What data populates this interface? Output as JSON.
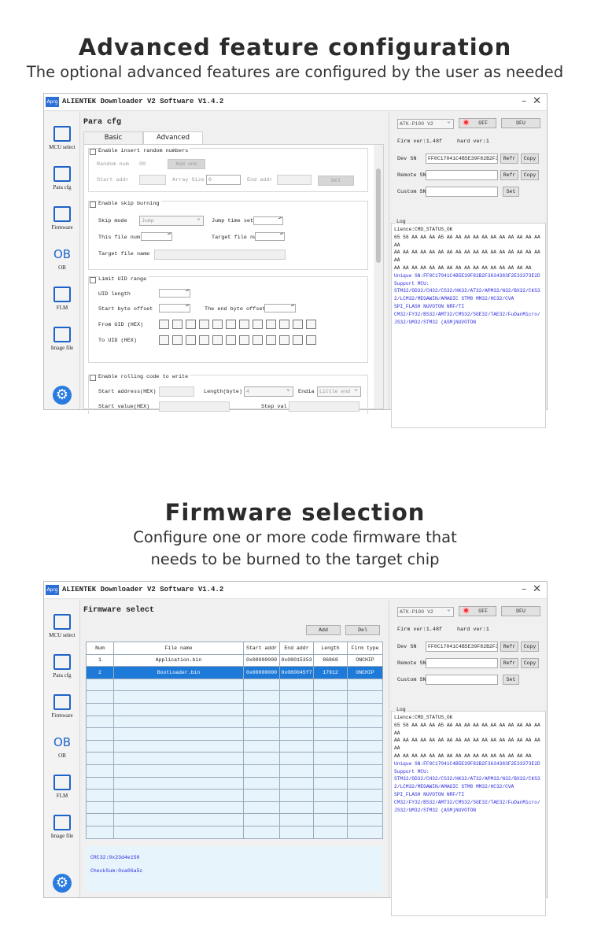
{
  "section1": {
    "heading": "Advanced feature configuration",
    "sub": "The optional advanced features are configured by the user as needed"
  },
  "section2": {
    "heading": "Firmware selection",
    "sub_line1": "Configure one or more code firmware that",
    "sub_line2": "needs to be burned to the target chip"
  },
  "window": {
    "icon_text": "Aprg",
    "title": "ALIENTEK  Downloader V2 Software V1.4.2",
    "min": "–",
    "close": "✕"
  },
  "sidebar": {
    "items": [
      {
        "label": "MCU select",
        "icon": "chip-icon"
      },
      {
        "label": "Para cfg",
        "icon": "list-icon"
      },
      {
        "label": "Firmware",
        "icon": "firmware-icon"
      },
      {
        "label": "OB",
        "icon": "ob-icon"
      },
      {
        "label": "FLM",
        "icon": "flm-icon"
      },
      {
        "label": "Image file",
        "icon": "image-file-icon"
      }
    ],
    "ob_glyph": "OB",
    "settings_icon": "gear-icon"
  },
  "para": {
    "title": "Para cfg",
    "tabs": [
      "Basic",
      "Advanced"
    ],
    "g1": {
      "title": "Enable insert random numbers",
      "random_num": "Random num",
      "random_val": "00",
      "add_one": "Add one",
      "start_addr": "Start addr",
      "array_size": "Array Size",
      "array_val": "0",
      "end_addr": "End addr",
      "del": "Del"
    },
    "g2": {
      "title": "Enable skip burning",
      "skip_mode": "Skip mode",
      "skip_val": "Jump",
      "jump_time_set": "Jump time set",
      "this_file_num": "This file num",
      "target_file_num": "Target file num",
      "target_file_name": "Target file name"
    },
    "g3": {
      "title": "Limit UID range",
      "uid_length": "UID length",
      "start_byte_offset": "Start byte offset",
      "end_byte_offset": "The end byte offset",
      "from_uid": "From UID (HEX)",
      "to_uid": "To UID (HEX)"
    },
    "g4": {
      "title": "Enable rolling code to write",
      "start_address": "Start address(HEX)",
      "length_byte": "Length(byte)",
      "length_val": "4",
      "endia": "Endia",
      "endia_val": "Little end",
      "start_value": "Start value(HEX)",
      "step_val": "Step val"
    }
  },
  "rightpanel": {
    "device": "ATK-P100 V2",
    "off": "OFF",
    "dfu": "DFU",
    "firm_ver": "Firm ver:1.48f",
    "hard_ver": "hard ver:1",
    "dev_sn": "Dev SN",
    "dev_sn_val": "FF0C17041C4B5E39F82B2F3",
    "refr": "Refr",
    "copy": "Copy",
    "remote_sn": "Remote SN",
    "custom_sn": "Custom SN",
    "set": "Set",
    "log_title": "Log",
    "log_lines": [
      {
        "t": "Lience:CMD_STATUS_OK",
        "c": "k"
      },
      {
        "t": "65 56 AA AA AA A5 AA AA AA AA AA AA AA AA AA AA AA AA",
        "c": "k"
      },
      {
        "t": "AA AA AA AA AA AA AA AA AA AA AA AA AA AA AA AA AA AA",
        "c": "k"
      },
      {
        "t": "AA AA AA AA AA AA AA AA AA AA AA AA AA AA AA AA",
        "c": "k"
      },
      {
        "t": "Unique SN:FF0C17041C4B5E39F82B2F3634383F2E33373E2D",
        "c": "b"
      },
      {
        "t": "Support MCU:",
        "c": "b"
      },
      {
        "t": "STM32/GD32/CH32/CS32/HK32/AT32/APM32/N32/BX32/CKS3",
        "c": "b"
      },
      {
        "t": "2/LCM32/MEGAWIN/AMAGIC STM8 MM32/HC32/CVA",
        "c": "b"
      },
      {
        "t": "SPI_FLASH NUVOTON NRF/TI",
        "c": "b"
      },
      {
        "t": "CM32/FY32/BS32/AMT32/CMS32/SGE32/TAE32/FuDanMicro/",
        "c": "b"
      },
      {
        "t": "JS32/UM32/STM32 (ASM)NUVOTON",
        "c": "b"
      }
    ]
  },
  "firmware": {
    "title": "Firmware select",
    "add": "Add",
    "del": "Del",
    "columns": [
      "Num",
      "File name",
      "Start addr",
      "End addr",
      "Length",
      "Firm type"
    ],
    "rows": [
      [
        "1",
        "Application.bin",
        "0x08000000",
        "0x08015353",
        "86868",
        "ONCHIP"
      ],
      [
        "2",
        "BootLoader.bin",
        "0x08000000",
        "0x080045f7",
        "17912",
        "ONCHIP"
      ]
    ],
    "crc": "CRC32:0x23d4e150",
    "checksum": "CheckSum:0xa06a5c"
  },
  "colors": {
    "accent": "#1e63c9",
    "selected_row": "#1e7ad9",
    "log_blue": "#2a2ae0",
    "led": "#e33333"
  }
}
